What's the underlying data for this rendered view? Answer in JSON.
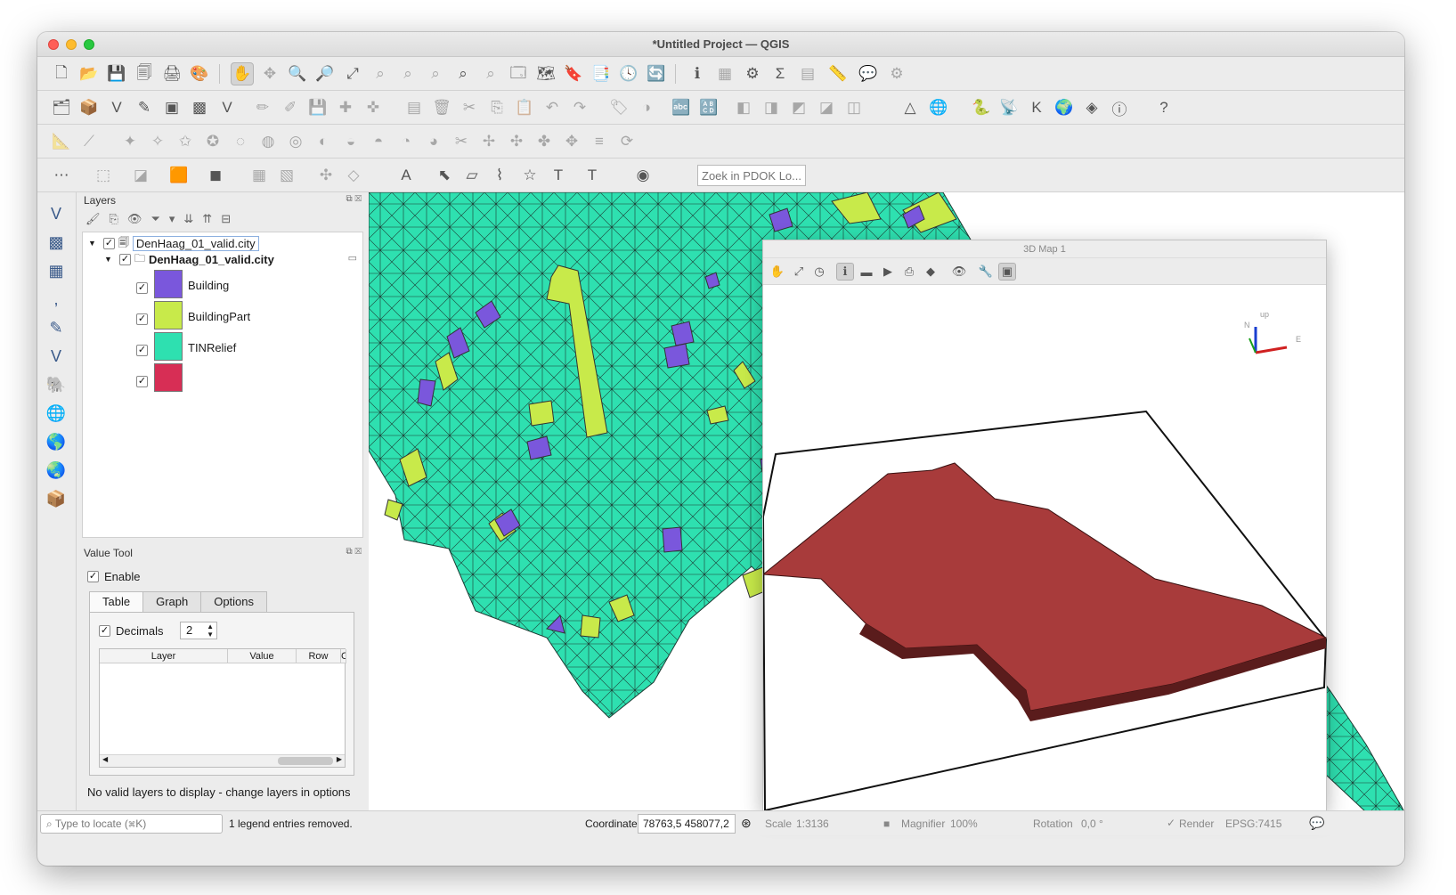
{
  "window": {
    "title": "*Untitled Project — QGIS"
  },
  "toolbars": {
    "pdok_search_placeholder": "Zoek in PDOK Lo..."
  },
  "layers_panel": {
    "title": "Layers",
    "group_file": "DenHaag_01_valid.city",
    "group_layer": "DenHaag_01_valid.city",
    "legend": [
      {
        "label": "Building",
        "color": "#7a57dc"
      },
      {
        "label": "BuildingPart",
        "color": "#c8ea4a"
      },
      {
        "label": "TINRelief",
        "color": "#2ee0b0"
      },
      {
        "label": "",
        "color": "#d72e55"
      }
    ]
  },
  "value_tool": {
    "title": "Value Tool",
    "enable_label": "Enable",
    "tabs": [
      "Table",
      "Graph",
      "Options"
    ],
    "decimals_label": "Decimals",
    "decimals_value": "2",
    "columns": [
      "Layer",
      "Value",
      "Row",
      "C"
    ],
    "message": "No valid layers to display - change layers in options"
  },
  "view3d": {
    "title": "3D Map 1",
    "axis_up": "up",
    "axis_n": "N",
    "axis_e": "E"
  },
  "statusbar": {
    "locate_placeholder": "Type to locate (⌘K)",
    "message": "1 legend entries removed.",
    "coordinate_label": "Coordinate",
    "coordinate_value": "78763,5 458077,2",
    "scale_label": "Scale",
    "scale_value": "1:3136",
    "magnifier_label": "Magnifier",
    "magnifier_value": "100%",
    "rotation_label": "Rotation",
    "rotation_value": "0,0 °",
    "render_label": "Render",
    "crs": "EPSG:7415"
  },
  "colors": {
    "tin": "#2ee0b0",
    "building": "#7a57dc",
    "building_part": "#c8ea4a",
    "relief3d": "#a83b3b"
  }
}
